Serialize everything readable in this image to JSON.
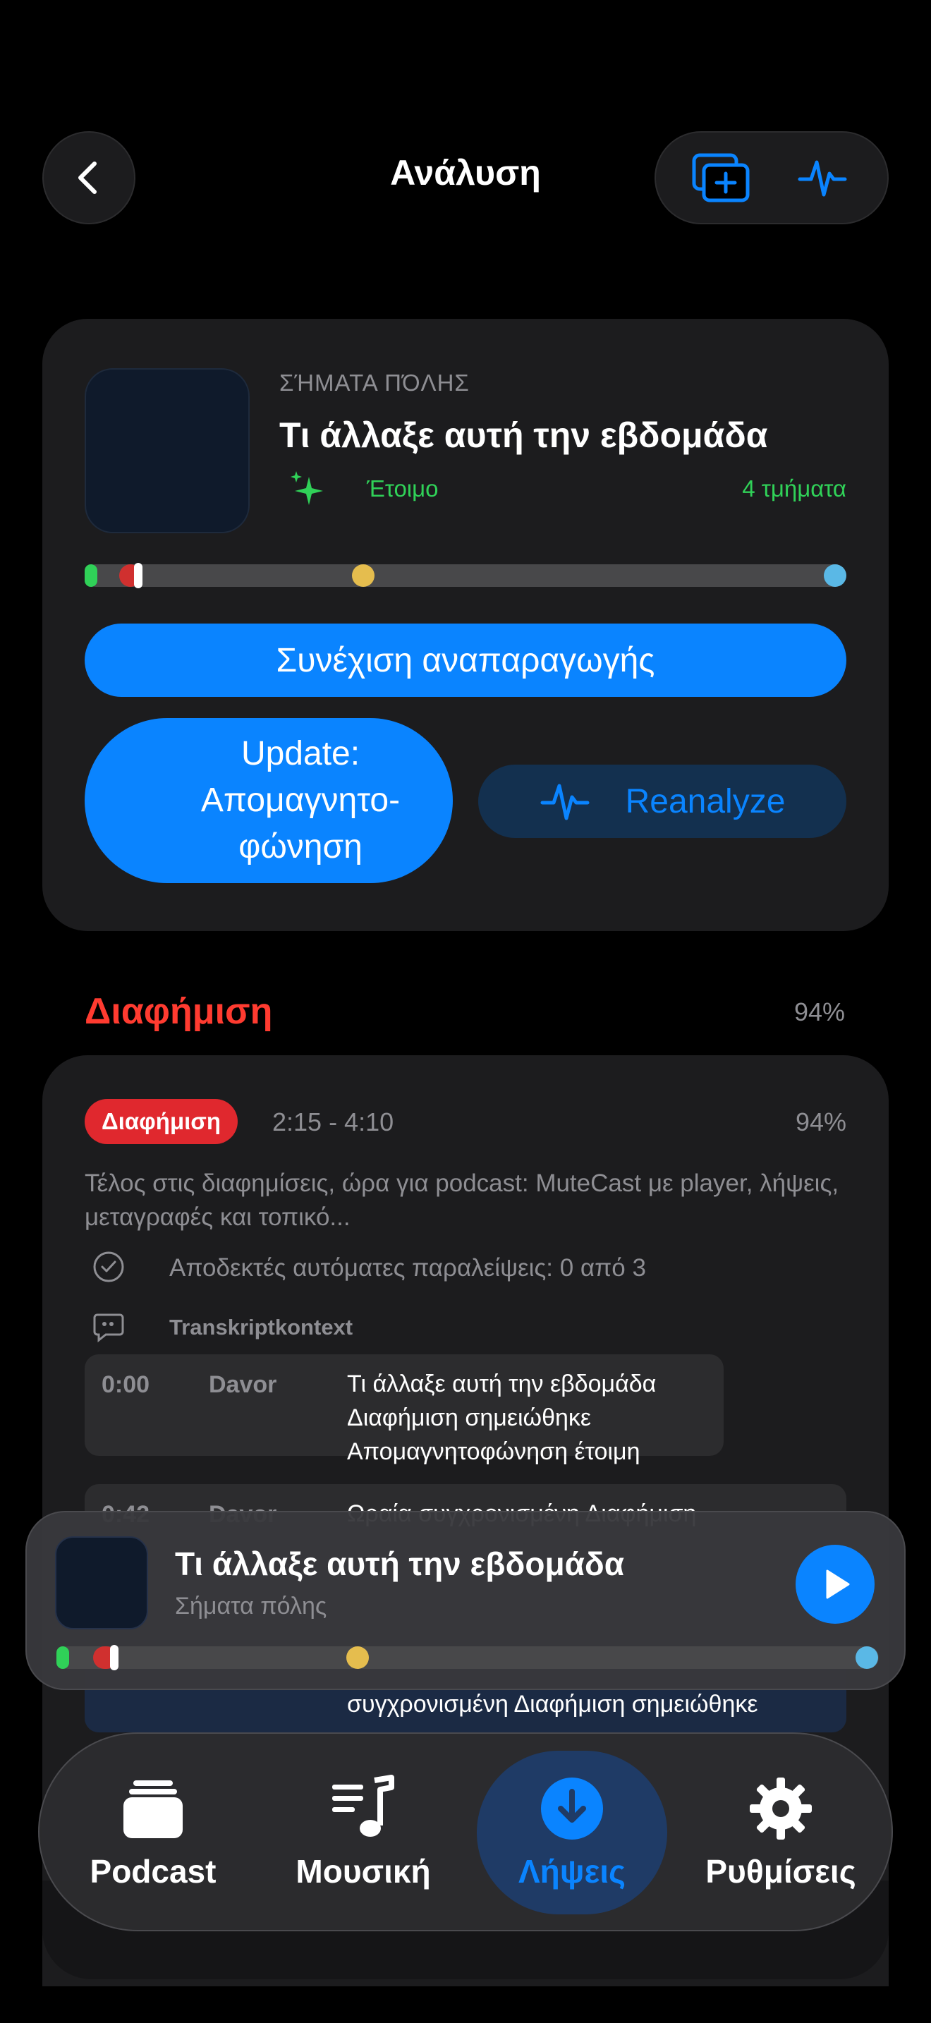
{
  "header": {
    "title": "Ανάλυση"
  },
  "episode": {
    "show": "ΣΉΜΑΤΑ ΠΌΛΗΣ",
    "title": "Τι άλλαξε αυτή την εβδομάδα",
    "status": "Έτοιμο",
    "segments": "4 τμήματα"
  },
  "buttons": {
    "resume": "Συνέχιση αναπαραγωγής",
    "update_line1": "Update:",
    "update_line2": "Απομαγνητο-",
    "update_line3": "φώνηση",
    "reanalyze": "Reanalyze"
  },
  "section": {
    "title": "Διαφήμιση",
    "confidence": "94%"
  },
  "segment": {
    "badge": "Διαφήμιση",
    "time_range": "2:15 - 4:10",
    "confidence": "94%",
    "description": "Τέλος στις διαφημίσεις, ώρα για podcast: MuteCast με player, λήψεις, μεταγραφές και τοπικό...",
    "skips": "Αποδεκτές αυτόματες παραλείψεις: 0 από 3",
    "context_title": "Transkriptkontext",
    "transcript": [
      {
        "time": "0:00",
        "speaker": "Davor",
        "lines": [
          "Τι άλλαξε αυτή την εβδομάδα",
          "Διαφήμιση σημειώθηκε",
          "Απομαγνητοφώνηση έτοιμη"
        ]
      },
      {
        "time": "0:42",
        "speaker": "Davor",
        "lines": [
          "Ωραία συγχρονισμένη Διαφήμιση"
        ]
      },
      {
        "lines": [
          "συγχρονισμένη Διαφήμιση σημειώθηκε"
        ]
      }
    ]
  },
  "mini_player": {
    "title": "Τι άλλαξε αυτή την εβδομάδα",
    "subtitle": "Σήματα πόλης"
  },
  "timeline": {
    "segments": [
      {
        "kind": "green",
        "color": "#30d158",
        "start": 0.0,
        "end": 0.014
      },
      {
        "kind": "red",
        "color": "#d0302f",
        "start": 0.045,
        "end": 0.075
      },
      {
        "kind": "yellow",
        "color": "#e5bd4e",
        "start": 0.352,
        "end": 0.38
      },
      {
        "kind": "blue",
        "color": "#5ab8e6",
        "start": 0.97,
        "end": 1.0
      }
    ],
    "playhead": 0.07
  },
  "tabs": [
    {
      "label": "Podcast",
      "icon": "stack-icon"
    },
    {
      "label": "Μουσική",
      "icon": "music-list-icon"
    },
    {
      "label": "Λήψεις",
      "icon": "download-icon",
      "active": true
    },
    {
      "label": "Ρυθμίσεις",
      "icon": "gear-icon"
    }
  ],
  "colors": {
    "accent": "#0a84ff",
    "ready": "#30d158",
    "ad": "#ff3b30"
  }
}
